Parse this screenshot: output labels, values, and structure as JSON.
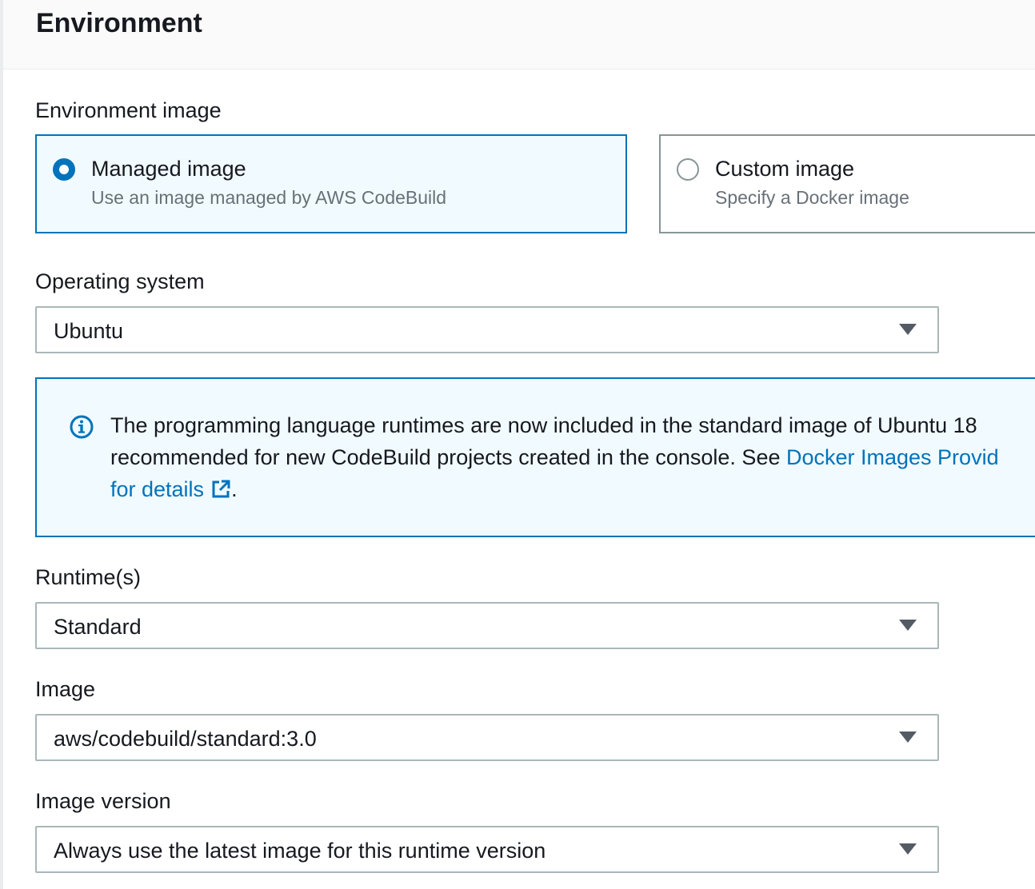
{
  "section": {
    "title": "Environment"
  },
  "environment_image": {
    "label": "Environment image",
    "options": [
      {
        "title": "Managed image",
        "description": "Use an image managed by AWS CodeBuild",
        "selected": true
      },
      {
        "title": "Custom image",
        "description": "Specify a Docker image",
        "selected": false
      }
    ]
  },
  "operating_system": {
    "label": "Operating system",
    "value": "Ubuntu"
  },
  "info_alert": {
    "line1": "The programming language runtimes are now included in the standard image of Ubuntu 18",
    "line2_text": "recommended for new CodeBuild projects created in the console. See ",
    "line2_link": "Docker Images Provid",
    "line3_link": "for details",
    "line3_tail": ".",
    "icon": "info-icon",
    "link_icon": "external-link-icon"
  },
  "runtimes": {
    "label": "Runtime(s)",
    "value": "Standard"
  },
  "image": {
    "label": "Image",
    "value": "aws/codebuild/standard:3.0"
  },
  "image_version": {
    "label": "Image version",
    "value": "Always use the latest image for this runtime version"
  },
  "colors": {
    "accent": "#0073bb",
    "info_bg": "#f1faff",
    "border": "#aab7b8"
  }
}
